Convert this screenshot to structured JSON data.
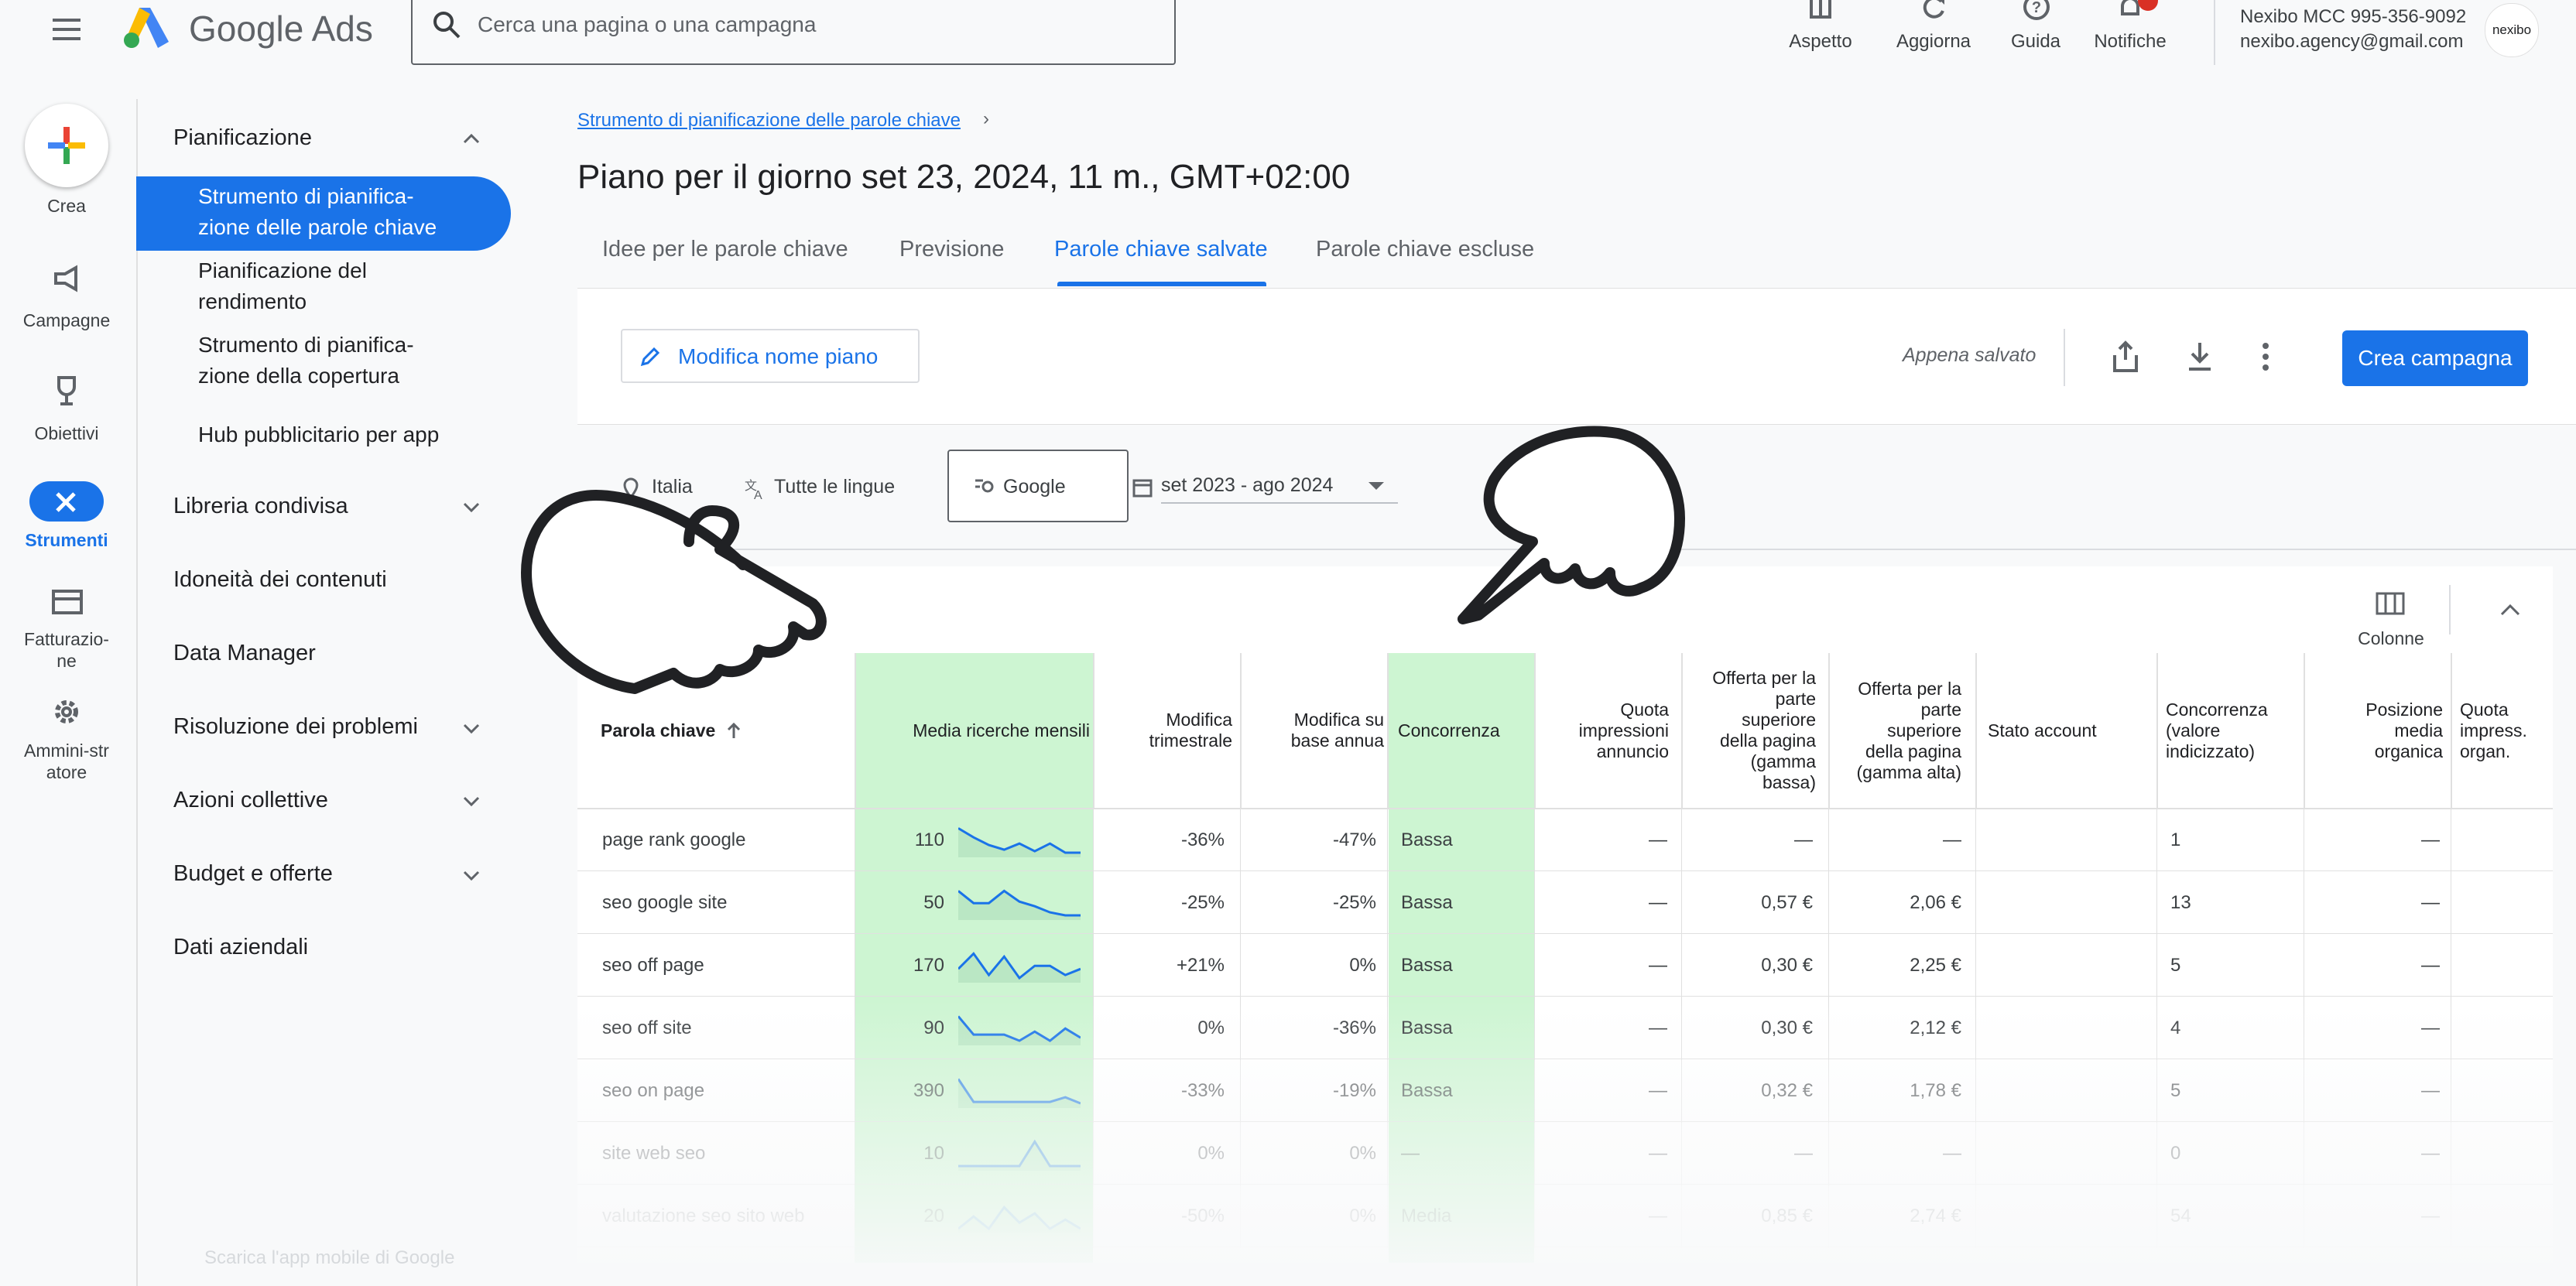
{
  "app": {
    "name": "Google Ads",
    "search_placeholder": "Cerca una pagina o una campagna"
  },
  "toolbar": {
    "appearance": "Aspetto",
    "refresh": "Aggiorna",
    "help": "Guida",
    "notifications": "Notifiche",
    "account_name": "Nexibo MCC 995-356-9092",
    "account_email": "nexibo.agency@gmail.com",
    "avatar_text": "nexibo"
  },
  "rail": {
    "create": "Crea",
    "campaigns": "Campagne",
    "goals": "Obiettivi",
    "tools": "Strumenti",
    "billing": "Fatturazio-ne",
    "admin": "Ammini-stratore"
  },
  "sidenav": {
    "planning": "Pianificazione",
    "sub": [
      {
        "label": "Strumento di pianifica-zione delle parole chiave"
      },
      {
        "label": "Pianificazione del rendimento"
      },
      {
        "label": "Strumento di pianifica-zione della copertura"
      },
      {
        "label": "Hub pubblicitario per app"
      }
    ],
    "shared_library": "Libreria condivisa",
    "content_suitability": "Idoneità dei contenuti",
    "data_manager": "Data Manager",
    "troubleshooting": "Risoluzione dei problemi",
    "bulk_actions": "Azioni collettive",
    "budget": "Budget e offerte",
    "business_data": "Dati aziendali",
    "mobile_app": "Scarica l'app mobile di Google"
  },
  "page": {
    "breadcrumb": "Strumento di pianificazione delle parole chiave",
    "title": "Piano per il giorno set 23, 2024, 11 m., GMT+02:00",
    "tabs": [
      "Idee per le parole chiave",
      "Previsione",
      "Parole chiave salvate",
      "Parole chiave escluse"
    ],
    "edit_plan": "Modifica nome piano",
    "saved_status": "Appena salvato",
    "create_campaign": "Crea campagna",
    "filters": {
      "location": "Italia",
      "language": "Tutte le lingue",
      "network": "Google",
      "date_range": "set 2023 - ago 2024"
    },
    "columns_button": "Colonne"
  },
  "table": {
    "headers": {
      "keyword": "Parola chiave",
      "avg_searches": "Media ricerche mensili",
      "qoq": [
        "Modifica",
        "trimestrale"
      ],
      "yoy": [
        "Modifica su",
        "base annua"
      ],
      "competition": "Concorrenza",
      "impr_share": [
        "Quota",
        "impressioni",
        "annuncio"
      ],
      "bid_low": [
        "Offerta per la",
        "parte",
        "superiore",
        "della pagina",
        "(gamma",
        "bassa)"
      ],
      "bid_high": [
        "Offerta per la",
        "parte",
        "superiore",
        "della pagina",
        "(gamma alta)"
      ],
      "account_status": "Stato account",
      "comp_index": [
        "Concorrenza",
        "(valore",
        "indicizzato)"
      ],
      "organic_pos": [
        "Posizione",
        "media",
        "organica"
      ],
      "organic_impr": [
        "Quota",
        "impress.",
        "organ."
      ]
    },
    "rows": [
      {
        "keyword": "page rank google",
        "searches": "110",
        "qoq": "-36%",
        "yoy": "-47%",
        "comp": "Bassa",
        "impr": "—",
        "low": "—",
        "high": "—",
        "index": "1",
        "pos": "—"
      },
      {
        "keyword": "seo google site",
        "searches": "50",
        "qoq": "-25%",
        "yoy": "-25%",
        "comp": "Bassa",
        "impr": "—",
        "low": "0,57 €",
        "high": "2,06 €",
        "index": "13",
        "pos": "—"
      },
      {
        "keyword": "seo off page",
        "searches": "170",
        "qoq": "+21%",
        "yoy": "0%",
        "comp": "Bassa",
        "impr": "—",
        "low": "0,30 €",
        "high": "2,25 €",
        "index": "5",
        "pos": "—"
      },
      {
        "keyword": "seo off site",
        "searches": "90",
        "qoq": "0%",
        "yoy": "-36%",
        "comp": "Bassa",
        "impr": "—",
        "low": "0,30 €",
        "high": "2,12 €",
        "index": "4",
        "pos": "—"
      },
      {
        "keyword": "seo on page",
        "searches": "390",
        "qoq": "-33%",
        "yoy": "-19%",
        "comp": "Bassa",
        "impr": "—",
        "low": "0,32 €",
        "high": "1,78 €",
        "index": "5",
        "pos": "—"
      },
      {
        "keyword": "site web seo",
        "searches": "10",
        "qoq": "0%",
        "yoy": "0%",
        "comp": "—",
        "impr": "—",
        "low": "—",
        "high": "—",
        "index": "0",
        "pos": "—"
      },
      {
        "keyword": "valutazione seo sito web",
        "searches": "20",
        "qoq": "-50%",
        "yoy": "0%",
        "comp": "Media",
        "impr": "—",
        "low": "0,85 €",
        "high": "2,74 €",
        "index": "54",
        "pos": "—"
      }
    ]
  },
  "colors": {
    "accent": "#1a73e8",
    "green_column": "#cdf5d2",
    "spark": "#1a73e8"
  }
}
